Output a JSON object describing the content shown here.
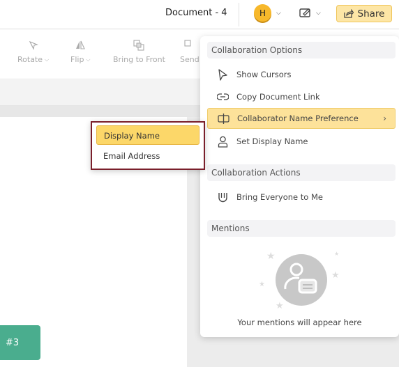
{
  "header": {
    "document_title": "Document - 4",
    "avatar_initial": "H",
    "share_label": "Share"
  },
  "toolbar": {
    "tools": [
      {
        "label": "Rotate",
        "icon": "rotate-icon"
      },
      {
        "label": "Flip",
        "icon": "flip-icon"
      },
      {
        "label": "Bring to Front",
        "icon": "bring-to-front-icon"
      },
      {
        "label": "Send",
        "icon": "send-backward-icon"
      }
    ]
  },
  "canvas": {
    "card_label": "#3",
    "card_color": "#4aad8e"
  },
  "collab_menu": {
    "options_heading": "Collaboration Options",
    "items": [
      {
        "label": "Show Cursors",
        "icon": "cursor-icon"
      },
      {
        "label": "Copy Document Link",
        "icon": "link-icon"
      },
      {
        "label": "Collaborator Name Preference",
        "icon": "name-preference-icon"
      },
      {
        "label": "Set Display Name",
        "icon": "user-icon"
      }
    ],
    "actions_heading": "Collaboration Actions",
    "actions": [
      {
        "label": "Bring Everyone to Me",
        "icon": "magnet-icon"
      }
    ],
    "mentions_heading": "Mentions",
    "mentions_empty": "Your mentions will appear here"
  },
  "name_submenu": {
    "items": [
      {
        "label": "Display Name",
        "selected": true
      },
      {
        "label": "Email Address",
        "selected": false
      }
    ]
  },
  "colors": {
    "accent": "#fde29a",
    "avatar": "#f7b82b",
    "highlight_border": "#7a1f2b"
  }
}
